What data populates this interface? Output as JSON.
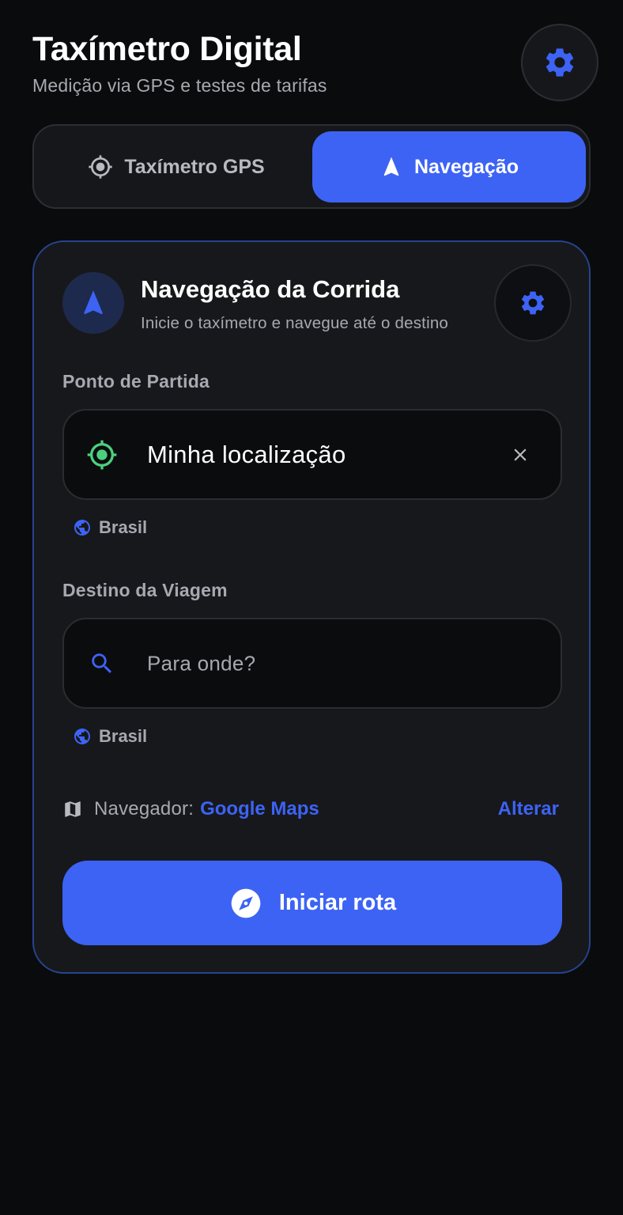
{
  "header": {
    "title": "Taxímetro Digital",
    "subtitle": "Medição via GPS e testes de tarifas"
  },
  "tabs": [
    {
      "label": "Taxímetro GPS",
      "icon": "gps-target-icon",
      "active": false
    },
    {
      "label": "Navegação",
      "icon": "navigation-arrow-icon",
      "active": true
    }
  ],
  "card": {
    "title": "Navegação da Corrida",
    "subtitle": "Inicie o taxímetro e navegue até o destino",
    "origin": {
      "label": "Ponto de Partida",
      "value": "Minha localização",
      "region": "Brasil"
    },
    "destination": {
      "label": "Destino da Viagem",
      "placeholder": "Para onde?",
      "value": "",
      "region": "Brasil"
    },
    "navigator": {
      "label": "Navegador:",
      "value": "Google Maps",
      "change_label": "Alterar"
    },
    "start_button": "Iniciar rota"
  },
  "colors": {
    "accent": "#3d63f5",
    "location_green": "#4cd07d",
    "background": "#0a0b0d",
    "card_border": "#27438f"
  }
}
